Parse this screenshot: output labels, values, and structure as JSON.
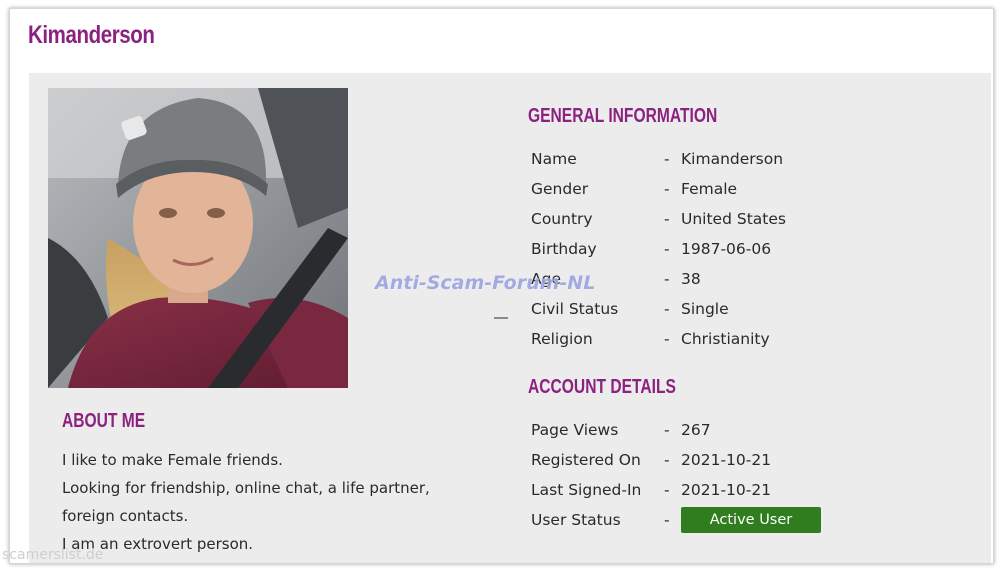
{
  "profile": {
    "username": "Kimanderson"
  },
  "about": {
    "title": "ABOUT ME",
    "lines": [
      "I like to make Female friends.",
      "Looking for friendship, online chat, a life partner, foreign contacts.",
      "I am an extrovert person."
    ]
  },
  "general": {
    "title": "GENERAL INFORMATION",
    "separator": "-",
    "rows": [
      {
        "label": "Name",
        "value": "Kimanderson"
      },
      {
        "label": "Gender",
        "value": "Female"
      },
      {
        "label": "Country",
        "value": "United States"
      },
      {
        "label": "Birthday",
        "value": "1987-06-06"
      },
      {
        "label": "Age",
        "value": "38"
      },
      {
        "label": "Civil Status",
        "value": "Single"
      },
      {
        "label": "Religion",
        "value": "Christianity"
      }
    ]
  },
  "account": {
    "title": "ACCOUNT DETAILS",
    "separator": "-",
    "rows": [
      {
        "label": "Page Views",
        "value": "267"
      },
      {
        "label": "Registered On",
        "value": "2021-10-21"
      },
      {
        "label": "Last Signed-In",
        "value": "2021-10-21"
      },
      {
        "label": "User Status",
        "value": "Active User"
      }
    ]
  },
  "watermarks": {
    "overlay": "Anti-Scam-Forum-NL",
    "corner": "scamerslist.de"
  },
  "colors": {
    "accent": "#8b2280",
    "status_active": "#2f7d1e",
    "panel_bg": "#ececec"
  }
}
